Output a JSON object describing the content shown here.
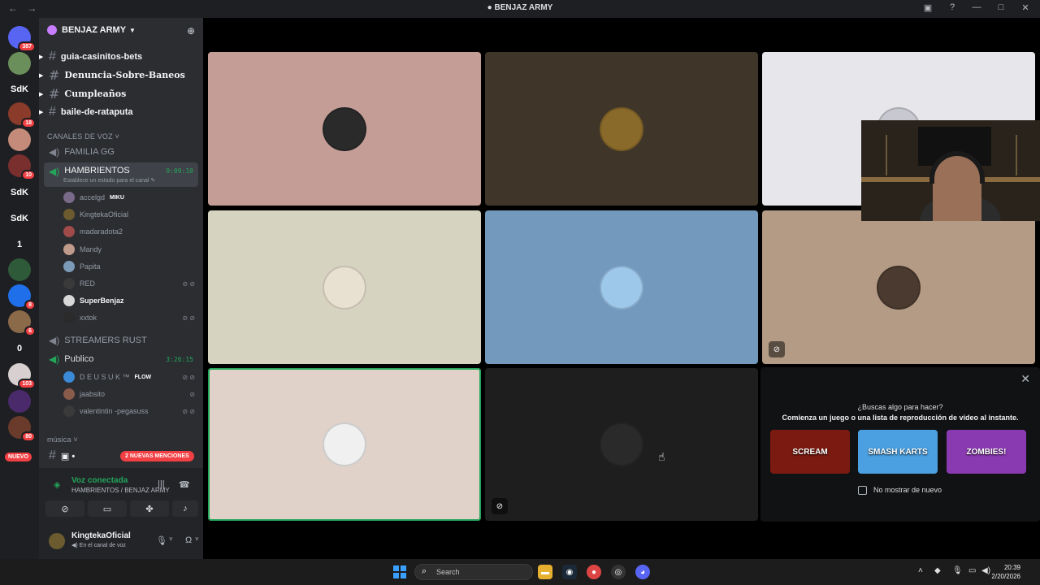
{
  "titlebar": {
    "title": "BENJAZ ARMY",
    "back": "←",
    "forward": "→"
  },
  "guilds": [
    {
      "label": "",
      "badge": "387",
      "color": "#5865f2"
    },
    {
      "label": "",
      "badge": "",
      "color": "#6b8f5a"
    },
    {
      "label": "SdK",
      "badge": "",
      "color": "#1e1f22"
    },
    {
      "label": "",
      "badge": "18",
      "color": "#8a3b2a"
    },
    {
      "label": "",
      "badge": "",
      "color": "#c48a7a"
    },
    {
      "label": "",
      "badge": "10",
      "color": "#7a2f2f"
    },
    {
      "label": "SdK",
      "badge": "",
      "color": "#1e1f22"
    },
    {
      "label": "SdK",
      "badge": "",
      "color": "#1e1f22"
    },
    {
      "label": "1",
      "badge": "",
      "color": "#1e1f22"
    },
    {
      "label": "",
      "badge": "",
      "color": "#2e5a3a"
    },
    {
      "label": "",
      "badge": "8",
      "color": "#1f6feb"
    },
    {
      "label": "",
      "badge": "6",
      "color": "#8b6a4a"
    },
    {
      "label": "0",
      "badge": "",
      "color": "#1e1f22"
    },
    {
      "label": "",
      "badge": "103",
      "color": "#d8d0d0"
    },
    {
      "label": "",
      "badge": "",
      "color": "#4a2a6a"
    },
    {
      "label": "",
      "badge": "80",
      "color": "#6a3a2a"
    }
  ],
  "nuevo": "NUEVO",
  "server": {
    "name": "BENJAZ ARMY"
  },
  "text_channels": [
    {
      "name": "guia-casinitos-bets"
    },
    {
      "name": "Denuncia-Sobre-Baneos"
    },
    {
      "name": "Cumpleaños"
    },
    {
      "name": "baile-de-rataputa"
    }
  ],
  "voice_category": "CANALES DE VOZ",
  "voice_channels": {
    "familia": "FAMILIA GG",
    "hambrientos": "HAMBRIENTOS",
    "hambrientos_timer": "9:09:10",
    "hambrientos_status": "Establece un estado para el canal",
    "streamers": "STREAMERS RUST",
    "publico": "Publico",
    "publico_timer": "3:26:15"
  },
  "hambrientos_members": [
    {
      "name": "accelgd",
      "tag": "MIKU",
      "color": "#7a6a8a",
      "icons": ""
    },
    {
      "name": "KingtekaOficial",
      "tag": "",
      "color": "#6b5b2e",
      "icons": ""
    },
    {
      "name": "madaradota2",
      "tag": "",
      "color": "#a04a4a",
      "icons": ""
    },
    {
      "name": "Mandy",
      "tag": "",
      "color": "#c09a8a",
      "icons": ""
    },
    {
      "name": "Papita",
      "tag": "",
      "color": "#7a9ab8",
      "icons": ""
    },
    {
      "name": "RED",
      "tag": "",
      "color": "#3a3a3a",
      "icons": "⊘ ⊘"
    },
    {
      "name": "SuperBenjaz",
      "tag": "",
      "color": "#d8d8d8",
      "icons": ""
    },
    {
      "name": "xxtok",
      "tag": "",
      "color": "#2a2a2a",
      "icons": "⊘ ⊘"
    }
  ],
  "publico_members": [
    {
      "name": "D E U S U K ™",
      "tag": "FLOW",
      "color": "#3a8ad8",
      "icons": "⊘ ⊘"
    },
    {
      "name": "jaabsito",
      "tag": "",
      "color": "#8a5a4a",
      "icons": "⊘"
    },
    {
      "name": "valentintin -pegasuss",
      "tag": "",
      "color": "#3a3a3a",
      "icons": "⊘ ⊘"
    }
  ],
  "music_category": "música",
  "mentions": "2 NUEVAS MENCIONES",
  "voice_panel": {
    "connected": "Voz conectada",
    "location": "HAMBRIENTOS / BENJAZ ARMY"
  },
  "user": {
    "name": "KingtekaOficial",
    "status": "En el canal de voz"
  },
  "tiles": [
    {
      "bg": "#c49d97",
      "avatar": "#2a2a2a",
      "mutecam": false,
      "speaking": false
    },
    {
      "bg": "#3f3528",
      "avatar": "#8a6a2a",
      "mutecam": false,
      "speaking": false
    },
    {
      "bg": "#e7e6ea",
      "avatar": "#c8c8d0",
      "mutecam": false,
      "speaking": false
    },
    {
      "bg": "#d7d3c1",
      "avatar": "#e8e0d0",
      "mutecam": false,
      "speaking": false
    },
    {
      "bg": "#7399bd",
      "avatar": "#9ec8ea",
      "mutecam": false,
      "speaking": false
    },
    {
      "bg": "#b39b85",
      "avatar": "#4a3a30",
      "mutecam": true,
      "speaking": false
    },
    {
      "bg": "#e0d2c9",
      "avatar": "#f0f0f0",
      "mutecam": false,
      "speaking": true
    },
    {
      "bg": "#1e1e1e",
      "avatar": "#2a2a2a",
      "mutecam": true,
      "speaking": false
    }
  ],
  "activity": {
    "question": "¿Buscas algo para hacer?",
    "subtitle": "Comienza un juego o una lista de reproducción de video al instante.",
    "games": [
      {
        "title": "SCREAM",
        "bg": "#7a1a10"
      },
      {
        "title": "SMASH KARTS",
        "bg": "#4aa0e0"
      },
      {
        "title": "ZOMBIES!",
        "bg": "#8a3ab0"
      }
    ],
    "dont_show": "No mostrar de nuevo"
  },
  "taskbar": {
    "search_placeholder": "Search",
    "time": "20:39",
    "date": "2/20/2026"
  }
}
